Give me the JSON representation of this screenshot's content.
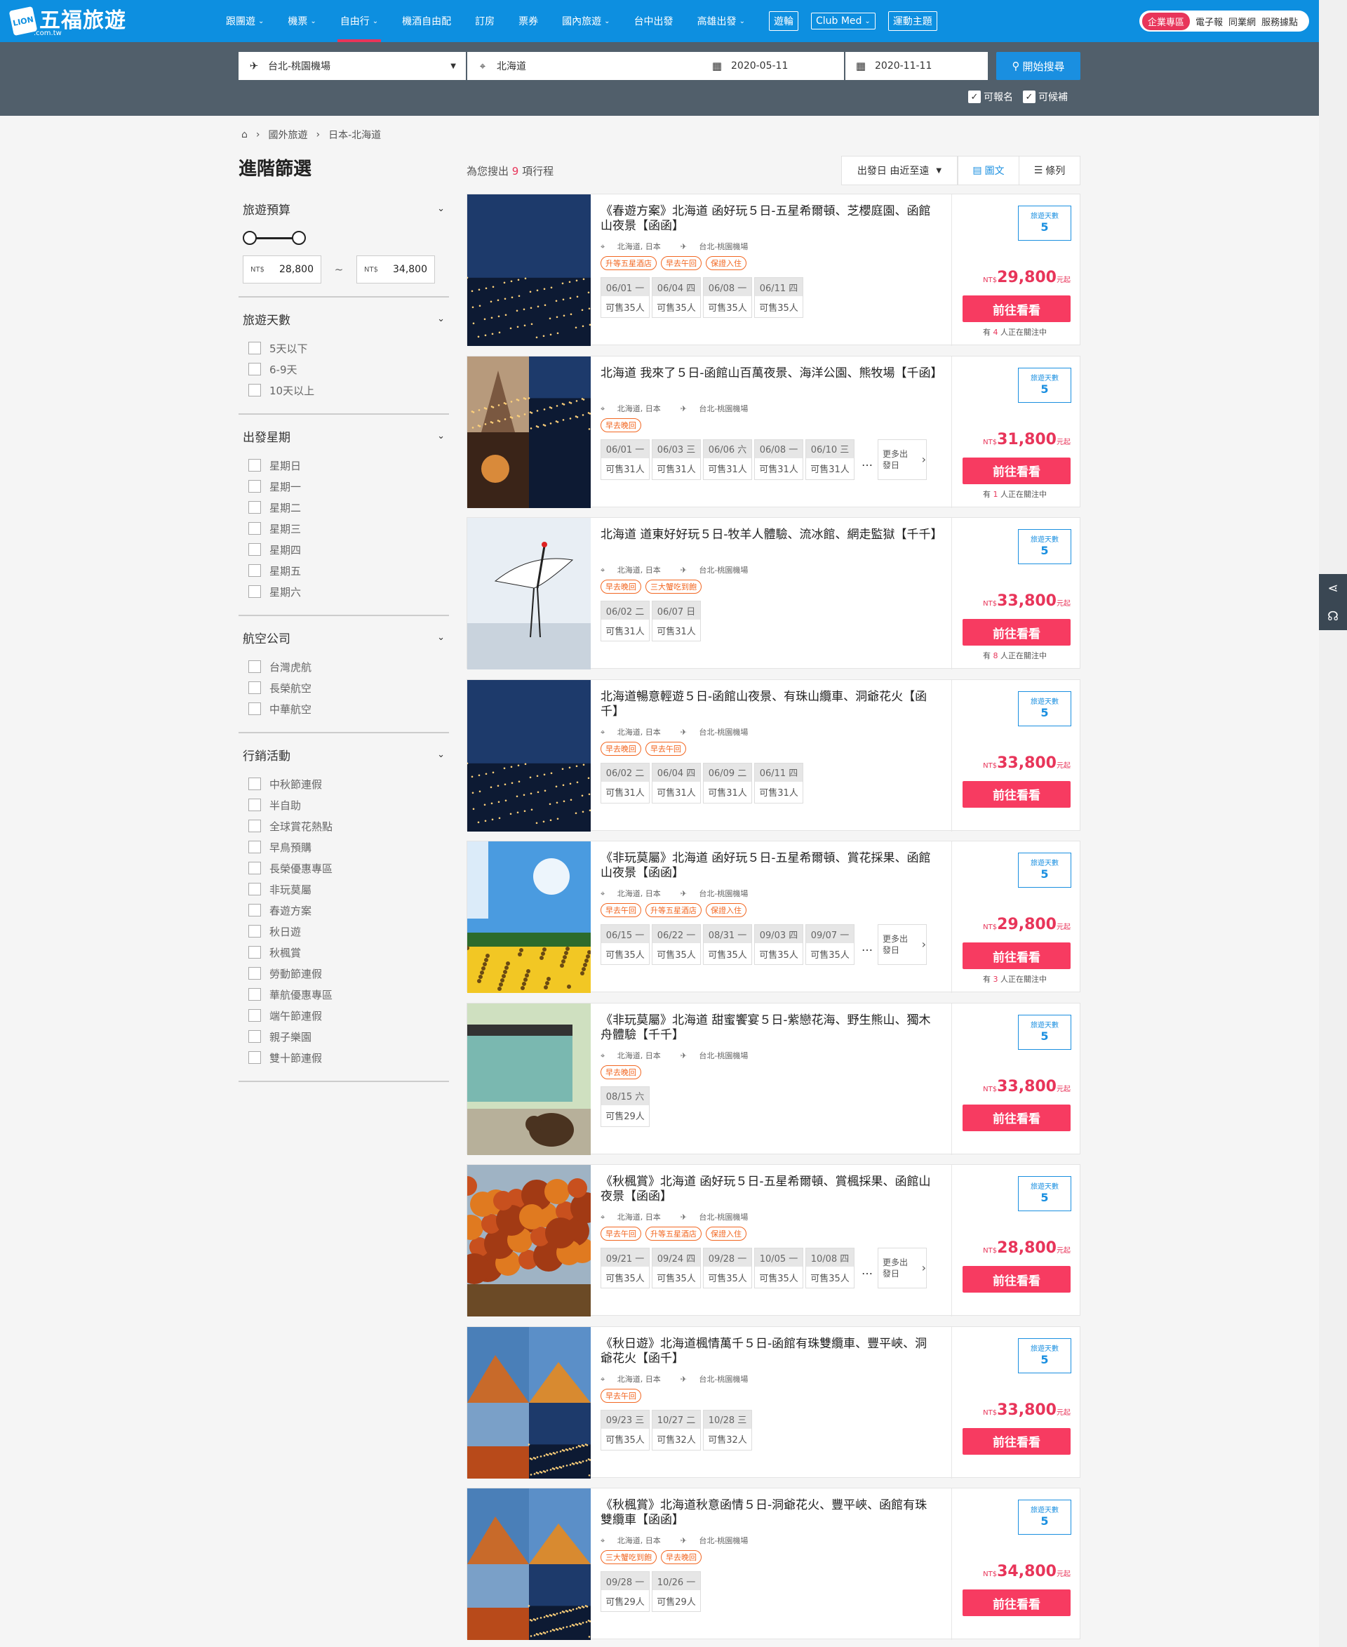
{
  "brand": {
    "name": "五福旅遊",
    "domain": ".com.tw",
    "badge": "LION"
  },
  "nav": [
    {
      "label": "跟團遊",
      "caret": true
    },
    {
      "label": "機票",
      "caret": true
    },
    {
      "label": "自由行",
      "caret": true,
      "active": true
    },
    {
      "label": "機酒自由配"
    },
    {
      "label": "訂房"
    },
    {
      "label": "票券"
    },
    {
      "label": "國內旅遊",
      "caret": true
    },
    {
      "label": "台中出發"
    },
    {
      "label": "高雄出發",
      "caret": true
    },
    {
      "label": "遊輪",
      "boxed": true
    },
    {
      "label": "Club Med",
      "caret": true,
      "boxed": true
    },
    {
      "label": "運動主題",
      "boxed": true
    }
  ],
  "top_right": {
    "corp": "企業專區",
    "links": [
      "電子報",
      "同業網",
      "服務據點"
    ]
  },
  "search": {
    "origin": "台北-桃園機場",
    "destination": "北海道",
    "date_from": "2020-05-11",
    "date_to": "2020-11-11",
    "button": "開始搜尋",
    "opt1": "可報名",
    "opt2": "可候補"
  },
  "breadcrumb": [
    "國外旅遊",
    "日本-北海道"
  ],
  "sidebar": {
    "title": "進階篩選",
    "budget": {
      "label": "旅遊預算",
      "currency": "NT$",
      "min": "28,800",
      "max": "34,800",
      "sep": "~"
    },
    "days": {
      "label": "旅遊天數",
      "options": [
        "5天以下",
        "6-9天",
        "10天以上"
      ]
    },
    "weekday": {
      "label": "出發星期",
      "options": [
        "星期日",
        "星期一",
        "星期二",
        "星期三",
        "星期四",
        "星期五",
        "星期六"
      ]
    },
    "airline": {
      "label": "航空公司",
      "options": [
        "台灣虎航",
        "長榮航空",
        "中華航空"
      ]
    },
    "promo": {
      "label": "行銷活動",
      "options": [
        "中秋節連假",
        "半自助",
        "全球賞花熱點",
        "早鳥預購",
        "長榮優惠專區",
        "非玩莫屬",
        "春遊方案",
        "秋日遊",
        "秋楓賞",
        "勞動節連假",
        "華航優惠專區",
        "端午節連假",
        "親子樂園",
        "雙十節連假"
      ]
    }
  },
  "results": {
    "prefix": "為您搜出",
    "count": "9",
    "suffix": "項行程",
    "sort": "出發日 由近至遠",
    "view_grid": "圖文",
    "view_list": "條列"
  },
  "labels": {
    "days": "旅遊天數",
    "go": "前往看看",
    "yuan": "元起",
    "currency": "NT$",
    "watch_pre": "有",
    "watch_post": "人正在關注中",
    "more": "更多出發日",
    "location": "北海道, 日本",
    "origin": "台北-桃園機場"
  },
  "colors": {
    "header": "#0d8fe0",
    "searchbar": "#515f6b",
    "accent": "#e8355a",
    "tag": "#f26722",
    "button": "#f73b61"
  },
  "cards": [
    {
      "title": "《春遊方案》北海道 函好玩５日-五星希爾頓、芝櫻庭園、函館山夜景【函函】",
      "tags": [
        "升等五星酒店",
        "早去午回",
        "保證入住"
      ],
      "dates": [
        [
          "06/01 一",
          "可售35人"
        ],
        [
          "06/04 四",
          "可售35人"
        ],
        [
          "06/08 一",
          "可售35人"
        ],
        [
          "06/11 四",
          "可售35人"
        ]
      ],
      "more": false,
      "days": "5",
      "price": "29,800",
      "watch": "4",
      "img": "night"
    },
    {
      "title": "北海道 我來了５日-函館山百萬夜景、海洋公園、熊牧場【千函】",
      "tags": [
        "早去晚回"
      ],
      "dates": [
        [
          "06/01 一",
          "可售31人"
        ],
        [
          "06/03 三",
          "可售31人"
        ],
        [
          "06/06 六",
          "可售31人"
        ],
        [
          "06/08 一",
          "可售31人"
        ],
        [
          "06/10 三",
          "可售31人"
        ]
      ],
      "more": true,
      "days": "5",
      "price": "31,800",
      "watch": "1",
      "img": "collage"
    },
    {
      "title": "北海道 道東好好玩５日-牧羊人體驗、流冰館、網走監獄【千千】",
      "tags": [
        "早去晚回",
        "三大蟹吃到飽"
      ],
      "dates": [
        [
          "06/02 二",
          "可售31人"
        ],
        [
          "06/07 日",
          "可售31人"
        ]
      ],
      "more": false,
      "days": "5",
      "price": "33,800",
      "watch": "8",
      "img": "crane"
    },
    {
      "title": "北海道暢意輕遊５日-函館山夜景、有珠山纜車、洞爺花火【函千】",
      "tags": [
        "早去晚回",
        "早去午回"
      ],
      "dates": [
        [
          "06/02 二",
          "可售31人"
        ],
        [
          "06/04 四",
          "可售31人"
        ],
        [
          "06/09 二",
          "可售31人"
        ],
        [
          "06/11 四",
          "可售31人"
        ]
      ],
      "more": false,
      "days": "5",
      "price": "33,800",
      "watch": "",
      "img": "night2"
    },
    {
      "title": "《非玩莫屬》北海道 函好玩５日-五星希爾頓、賞花採果、函館山夜景【函函】",
      "tags": [
        "早去午回",
        "升等五星酒店",
        "保證入住"
      ],
      "dates": [
        [
          "06/15 一",
          "可售35人"
        ],
        [
          "06/22 一",
          "可售35人"
        ],
        [
          "08/31 一",
          "可售35人"
        ],
        [
          "09/03 四",
          "可售35人"
        ],
        [
          "09/07 一",
          "可售35人"
        ]
      ],
      "more": true,
      "days": "5",
      "price": "29,800",
      "watch": "3",
      "img": "sunflower"
    },
    {
      "title": "《非玩莫屬》北海道 甜蜜饗宴５日-紫戀花海、野生熊山、獨木舟體驗【千千】",
      "tags": [
        "早去晚回"
      ],
      "dates": [
        [
          "08/15 六",
          "可售29人"
        ]
      ],
      "more": false,
      "days": "5",
      "price": "33,800",
      "watch": "",
      "img": "bear"
    },
    {
      "title": "《秋楓賞》北海道 函好玩５日-五星希爾頓、賞楓採果、函館山夜景【函函】",
      "tags": [
        "早去午回",
        "升等五星酒店",
        "保證入住"
      ],
      "dates": [
        [
          "09/21 一",
          "可售35人"
        ],
        [
          "09/24 四",
          "可售35人"
        ],
        [
          "09/28 一",
          "可售35人"
        ],
        [
          "10/05 一",
          "可售35人"
        ],
        [
          "10/08 四",
          "可售35人"
        ]
      ],
      "more": true,
      "days": "5",
      "price": "28,800",
      "watch": "",
      "img": "autumn"
    },
    {
      "title": "《秋日遊》北海道楓情萬千５日-函館有珠雙纜車、豐平峽、洞爺花火【函千】",
      "tags": [
        "早去午回"
      ],
      "dates": [
        [
          "09/23 三",
          "可售35人"
        ],
        [
          "10/27 二",
          "可售32人"
        ],
        [
          "10/28 三",
          "可售32人"
        ]
      ],
      "more": false,
      "days": "5",
      "price": "33,800",
      "watch": "",
      "img": "autumn4"
    },
    {
      "title": "《秋楓賞》北海道秋意函情５日-洞爺花火、豐平峽、函館有珠雙纜車【函函】",
      "tags": [
        "三大蟹吃到飽",
        "早去晚回"
      ],
      "dates": [
        [
          "09/28 一",
          "可售29人"
        ],
        [
          "10/26 一",
          "可售29人"
        ]
      ],
      "more": false,
      "days": "5",
      "price": "34,800",
      "watch": "",
      "img": "autumn4"
    }
  ]
}
